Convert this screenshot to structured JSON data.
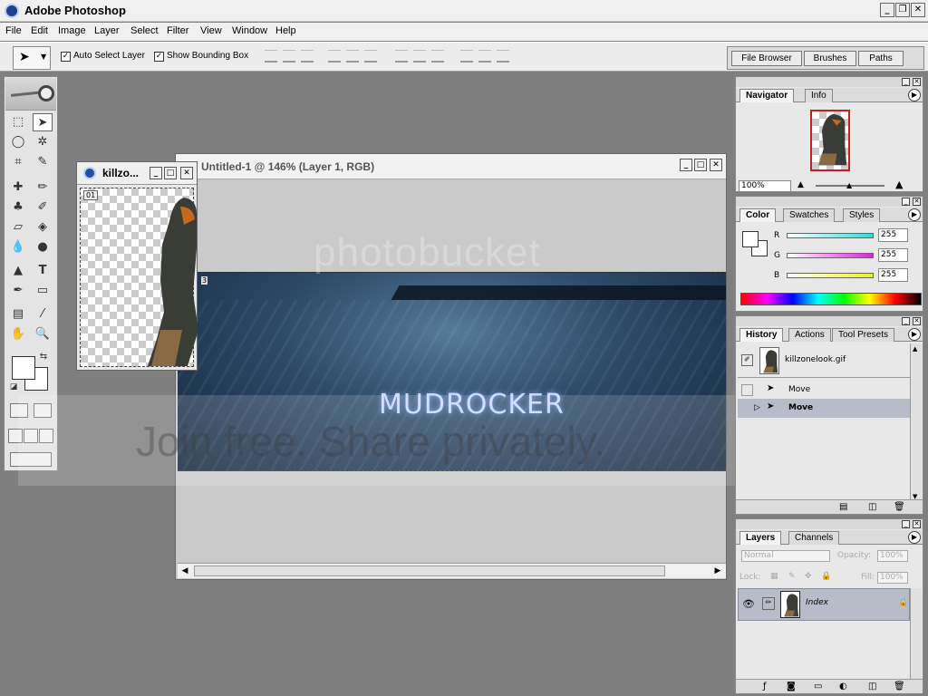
{
  "app": {
    "title": "Adobe Photoshop"
  },
  "menu": [
    "File",
    "Edit",
    "Image",
    "Layer",
    "Select",
    "Filter",
    "View",
    "Window",
    "Help"
  ],
  "options": {
    "auto_select_layer": "Auto Select Layer",
    "show_bounding_box": "Show Bounding Box",
    "auto_select_checked": "✓",
    "bounding_checked": "✓"
  },
  "well_tabs": [
    "File Browser",
    "Brushes",
    "Paths"
  ],
  "small_window": {
    "title": "killzo...",
    "frame": "01"
  },
  "document": {
    "title": "Untitled-1 @ 146% (Layer 1, RGB)",
    "banner_text": "MUDROCKER",
    "banner_marker": "3"
  },
  "watermark": {
    "brand": "photobucket",
    "slogan": "Join free. Share privately."
  },
  "navigator": {
    "tabs": [
      "Navigator",
      "Info"
    ],
    "zoom": "100%"
  },
  "color": {
    "tabs": [
      "Color",
      "Swatches",
      "Styles"
    ],
    "channels": [
      {
        "label": "R",
        "value": "255"
      },
      {
        "label": "G",
        "value": "255"
      },
      {
        "label": "B",
        "value": "255"
      }
    ],
    "channel_colors": [
      "#22e0e0",
      "#e020e0",
      "#f0f020"
    ]
  },
  "history": {
    "tabs": [
      "History",
      "Actions",
      "Tool Presets"
    ],
    "snapshot": "killzonelook.gif",
    "steps": [
      "Move",
      "Move"
    ]
  },
  "layers": {
    "tabs": [
      "Layers",
      "Channels"
    ],
    "blend_mode": "Normal",
    "opacity_label": "Opacity:",
    "opacity": "100%",
    "lock_label": "Lock:",
    "fill_label": "Fill:",
    "fill": "100%",
    "layer_name": "Index"
  }
}
